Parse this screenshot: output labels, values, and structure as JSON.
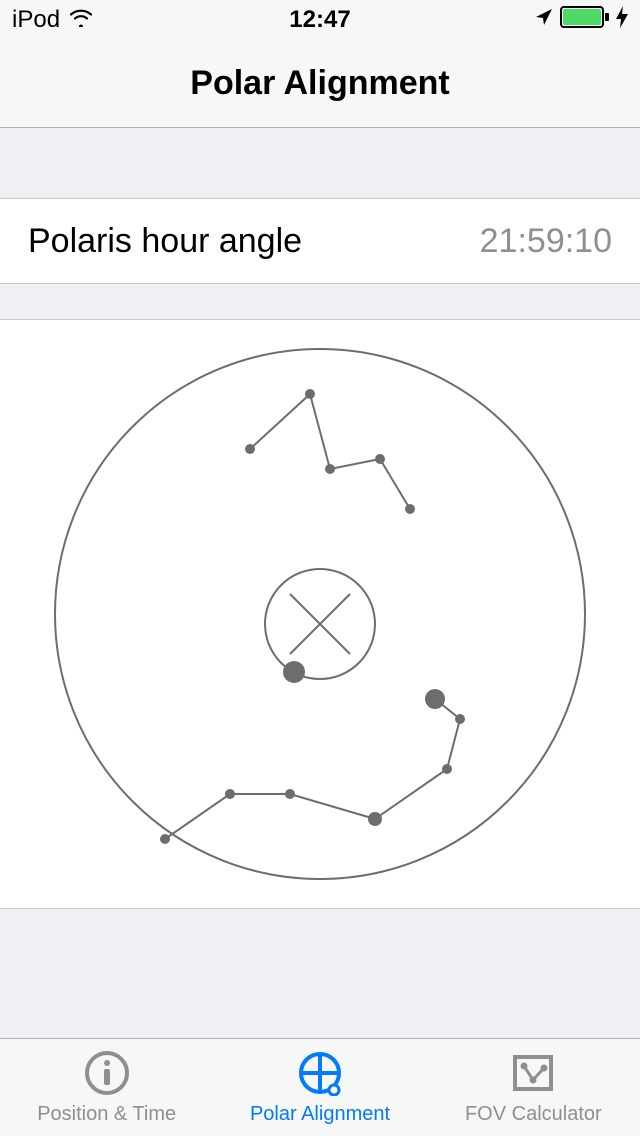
{
  "statusBar": {
    "device": "iPod",
    "time": "12:47"
  },
  "navBar": {
    "title": "Polar Alignment"
  },
  "main": {
    "hourAngleLabel": "Polaris hour angle",
    "hourAngleValue": "21:59:10"
  },
  "tabs": [
    {
      "label": "Position & Time"
    },
    {
      "label": "Polar Alignment"
    },
    {
      "label": "FOV Calculator"
    }
  ],
  "colors": {
    "accent": "#007aff",
    "battery": "#4cd964",
    "inactive": "#8e8e93"
  }
}
